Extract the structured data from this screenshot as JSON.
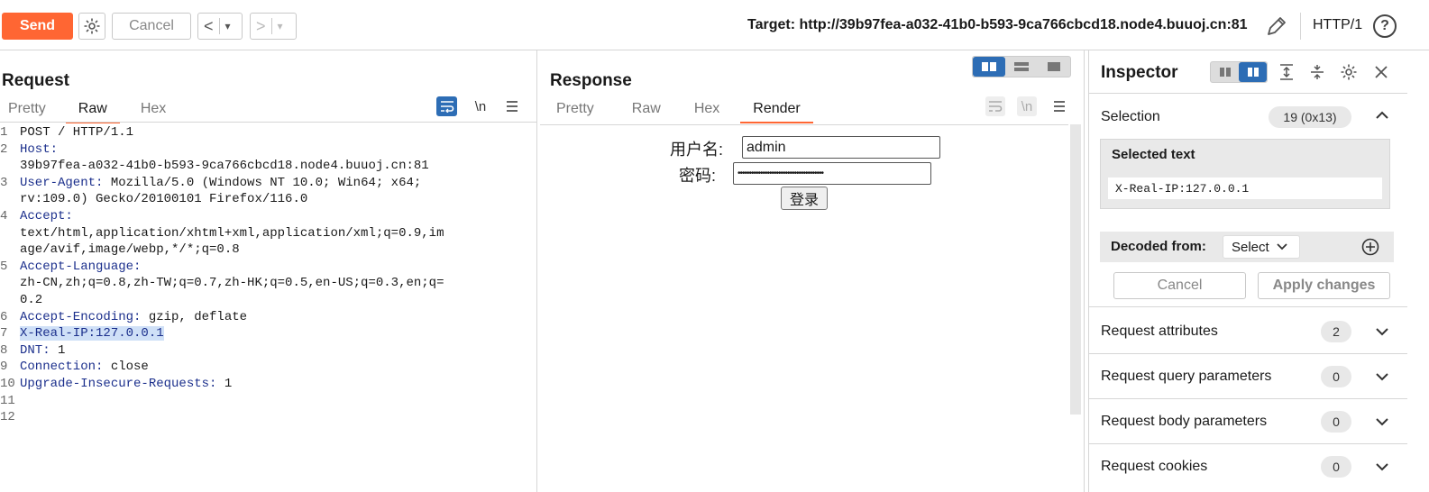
{
  "toolbar": {
    "send": "Send",
    "cancel": "Cancel",
    "back": "<",
    "forward": ">",
    "dropdown": "▾",
    "target": "Target: http://39b97fea-a032-41b0-b593-9ca766cbcd18.node4.buuoj.cn:81",
    "http_version": "HTTP/1",
    "help": "?"
  },
  "request": {
    "title": "Request",
    "tabs": [
      "Pretty",
      "Raw",
      "Hex"
    ],
    "active_tab": "Raw",
    "newline_icon": "\\n",
    "lines": [
      {
        "n": "1",
        "key": "",
        "rest": "POST / HTTP/1.1"
      },
      {
        "n": "2",
        "key": "Host:",
        "rest": ""
      },
      {
        "n": "",
        "key": "",
        "rest": "39b97fea-a032-41b0-b593-9ca766cbcd18.node4.buuoj.cn:81"
      },
      {
        "n": "3",
        "key": "User-Agent:",
        "rest": " Mozilla/5.0 (Windows NT 10.0; Win64; x64;"
      },
      {
        "n": "",
        "key": "",
        "rest": "rv:109.0) Gecko/20100101 Firefox/116.0"
      },
      {
        "n": "4",
        "key": "Accept:",
        "rest": ""
      },
      {
        "n": "",
        "key": "",
        "rest": "text/html,application/xhtml+xml,application/xml;q=0.9,im"
      },
      {
        "n": "",
        "key": "",
        "rest": "age/avif,image/webp,*/*;q=0.8"
      },
      {
        "n": "5",
        "key": "Accept-Language:",
        "rest": ""
      },
      {
        "n": "",
        "key": "",
        "rest": "zh-CN,zh;q=0.8,zh-TW;q=0.7,zh-HK;q=0.5,en-US;q=0.3,en;q="
      },
      {
        "n": "",
        "key": "",
        "rest": "0.2"
      },
      {
        "n": "6",
        "key": "Accept-Encoding:",
        "rest": " gzip, deflate"
      },
      {
        "n": "7",
        "key": "X-Real-IP:127.0.0.1",
        "rest": "",
        "highlight": true
      },
      {
        "n": "8",
        "key": "DNT:",
        "rest": " 1"
      },
      {
        "n": "9",
        "key": "Connection:",
        "rest": " close"
      },
      {
        "n": "10",
        "key": "Upgrade-Insecure-Requests:",
        "rest": " 1"
      },
      {
        "n": "11",
        "key": "",
        "rest": ""
      },
      {
        "n": "12",
        "key": "",
        "rest": ""
      }
    ]
  },
  "response": {
    "title": "Response",
    "tabs": [
      "Pretty",
      "Raw",
      "Hex",
      "Render"
    ],
    "active_tab": "Render",
    "newline_icon": "\\n",
    "render": {
      "username_label": "用户名:",
      "username_value": "admin",
      "password_label": "密码:",
      "password_value": "••••••••••••••••••••••••••••••••••••••",
      "submit": "登录"
    }
  },
  "inspector": {
    "title": "Inspector",
    "selection_label": "Selection",
    "selection_count": "19 (0x13)",
    "selected_text_label": "Selected text",
    "selected_text": "X-Real-IP:127.0.0.1",
    "decoded_from_label": "Decoded from:",
    "decoded_select": "Select",
    "cancel": "Cancel",
    "apply": "Apply changes",
    "sections": [
      {
        "label": "Request attributes",
        "count": "2"
      },
      {
        "label": "Request query parameters",
        "count": "0"
      },
      {
        "label": "Request body parameters",
        "count": "0"
      },
      {
        "label": "Request cookies",
        "count": "0"
      }
    ]
  },
  "colors": {
    "accent": "#ff6633",
    "header_key": "#1b2f8c",
    "selection_highlight": "#cfe0f7",
    "toggle_on": "#2d6db5"
  }
}
